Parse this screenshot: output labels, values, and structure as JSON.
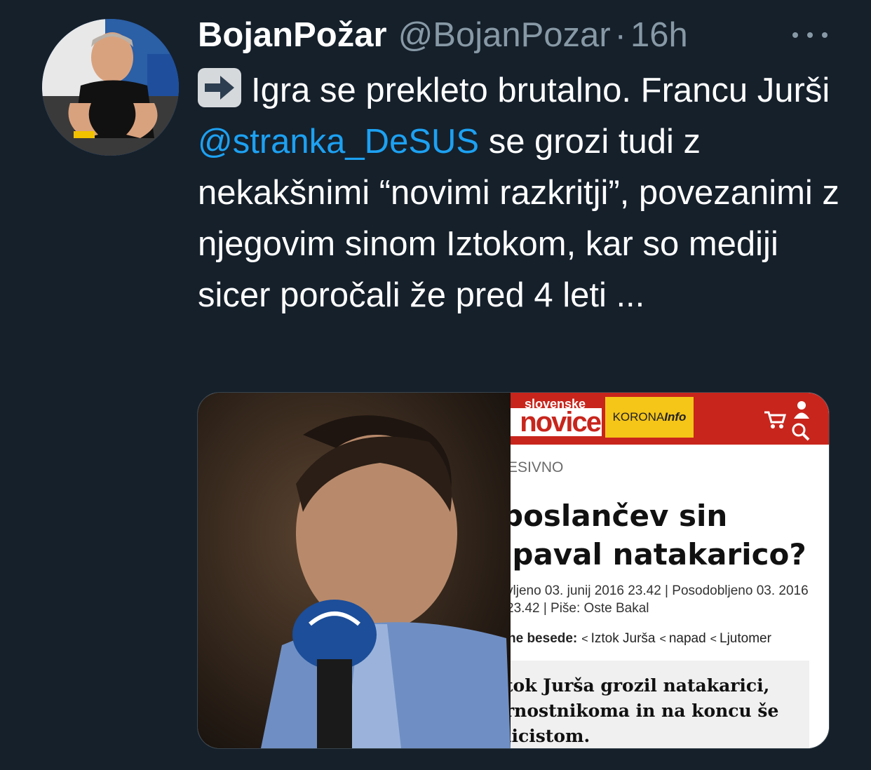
{
  "tweet": {
    "display_name": "BojanPožar",
    "handle": "@BojanPozar",
    "separator": "·",
    "time": "16h",
    "text_1": "Igra se prekleto brutalno. Francu Jurši ",
    "mention": "@stranka_DeSUS",
    "text_2": " se grozi tudi z nekakšnimi “novimi razkritji”, povezanimi z njegovim sinom Iztokom, kar so mediji sicer poročali že pred 4 leti ...",
    "emoji": "right-arrow-emoji"
  },
  "media": {
    "clip": {
      "logo_top": "slovenske",
      "logo_main": "novice",
      "korona_text": "KORONA",
      "korona_suffix": "Info",
      "section": "ESIVNO",
      "headline": "poslančev sin ipaval natakarico?",
      "meta": "vljeno 03. junij 2016 23.42 | Posodobljeno 03. 2016 23.42 | Piše: Oste Bakal",
      "tags_label": "ne besede:",
      "tags": [
        "Iztok Jurša",
        "napad",
        "Ljutomer"
      ],
      "lead": "tok Jurša grozil natakarici, rnostnikoma in na koncu še licistom."
    }
  },
  "colors": {
    "background": "#15202b",
    "secondary_text": "#8899a6",
    "link": "#1da1f2",
    "news_red": "#c8251c",
    "korona_yellow": "#f5c518"
  }
}
